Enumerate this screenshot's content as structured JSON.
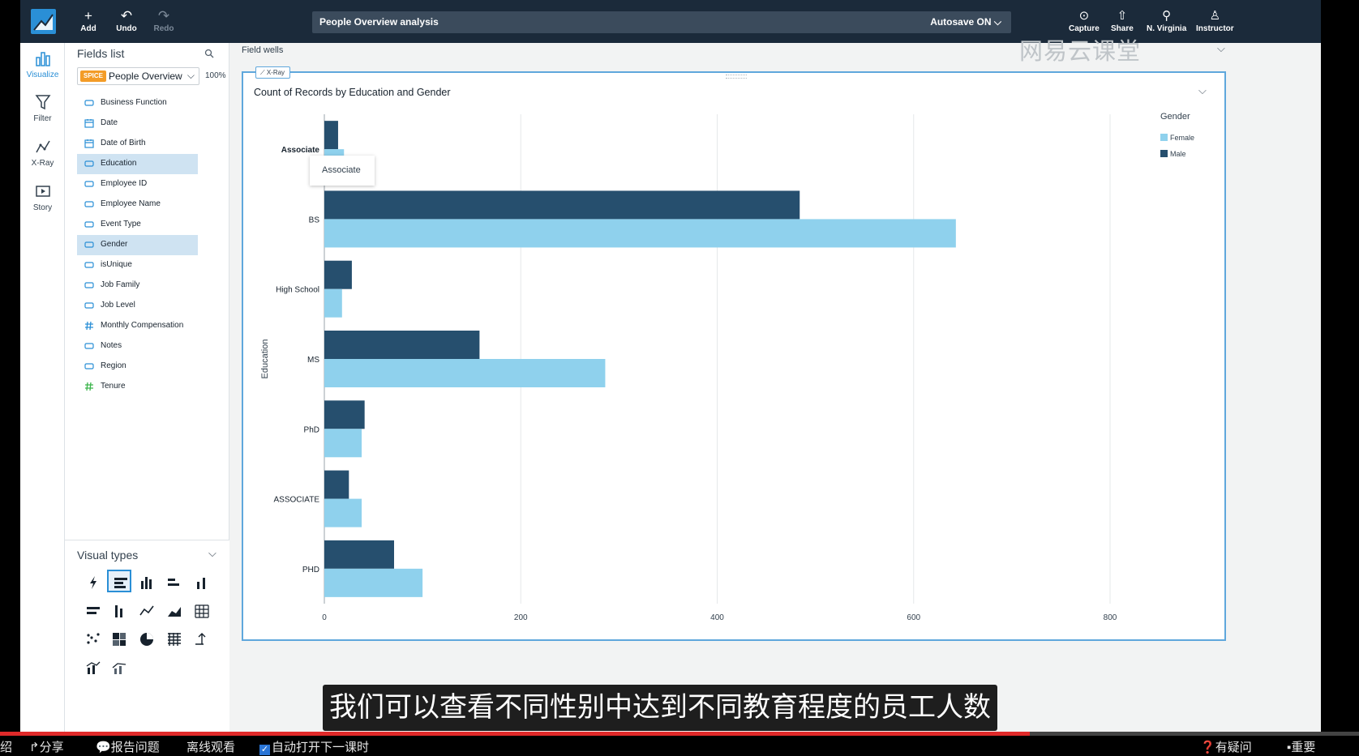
{
  "toolbar": {
    "add_label": "Add",
    "undo_label": "Undo",
    "redo_label": "Redo",
    "analysis_title": "People Overview analysis",
    "autosave_label": "Autosave ON",
    "capture_label": "Capture",
    "share_label": "Share",
    "region_label": "N. Virginia",
    "user_label": "Instructor"
  },
  "rail": {
    "visualize": "Visualize",
    "filter": "Filter",
    "xray": "X-Ray",
    "story": "Story"
  },
  "fields_panel": {
    "title": "Fields list",
    "spice_badge": "SPICE",
    "dataset_name": "People Overview",
    "dataset_percent": "100%",
    "fields": [
      {
        "label": "Business Function",
        "type": "dimension",
        "selected": false
      },
      {
        "label": "Date",
        "type": "date",
        "selected": false
      },
      {
        "label": "Date of Birth",
        "type": "date",
        "selected": false
      },
      {
        "label": "Education",
        "type": "dimension",
        "selected": true
      },
      {
        "label": "Employee ID",
        "type": "dimension",
        "selected": false
      },
      {
        "label": "Employee Name",
        "type": "dimension",
        "selected": false
      },
      {
        "label": "Event Type",
        "type": "dimension",
        "selected": false
      },
      {
        "label": "Gender",
        "type": "dimension",
        "selected": true
      },
      {
        "label": "isUnique",
        "type": "dimension",
        "selected": false
      },
      {
        "label": "Job Family",
        "type": "dimension",
        "selected": false
      },
      {
        "label": "Job Level",
        "type": "dimension",
        "selected": false
      },
      {
        "label": "Monthly Compensation",
        "type": "measure",
        "selected": false
      },
      {
        "label": "Notes",
        "type": "dimension",
        "selected": false
      },
      {
        "label": "Region",
        "type": "dimension",
        "selected": false
      },
      {
        "label": "Tenure",
        "type": "measure-green",
        "selected": false
      }
    ]
  },
  "visual_types": {
    "title": "Visual types"
  },
  "main": {
    "field_wells_label": "Field wells",
    "watermark": "网易云课堂",
    "xray_tag": "X-Ray",
    "tooltip_text": "Associate"
  },
  "chart_data": {
    "type": "bar",
    "orientation": "horizontal",
    "title": "Count of Records by Education and Gender",
    "ylabel": "Education",
    "xlabel": "",
    "categories": [
      "Associate",
      "BS",
      "High School",
      "MS",
      "PhD",
      "ASSOCIATE",
      "PHD"
    ],
    "series": [
      {
        "name": "Male",
        "values": [
          14,
          484,
          28,
          158,
          41,
          25,
          71
        ],
        "color": "#264f6e"
      },
      {
        "name": "Female",
        "values": [
          20,
          643,
          18,
          286,
          38,
          38,
          100
        ],
        "color": "#8fd1ed"
      }
    ],
    "xlim": [
      0,
      800
    ],
    "xticks": [
      0,
      200,
      400,
      600,
      800
    ],
    "legend_title": "Gender",
    "legend_entries": [
      "Female",
      "Male"
    ],
    "legend_placement": "top-right",
    "grid": "vertical"
  },
  "subtitle": "我们可以查看不同性别中达到不同教育程度的员工人数",
  "player": {
    "progress": 0.758,
    "left_cut": "绍",
    "share": "分享",
    "report": "报告问题",
    "offline": "离线观看",
    "autoplay": "自动打开下一课时",
    "question": "有疑问",
    "key": "重要"
  }
}
